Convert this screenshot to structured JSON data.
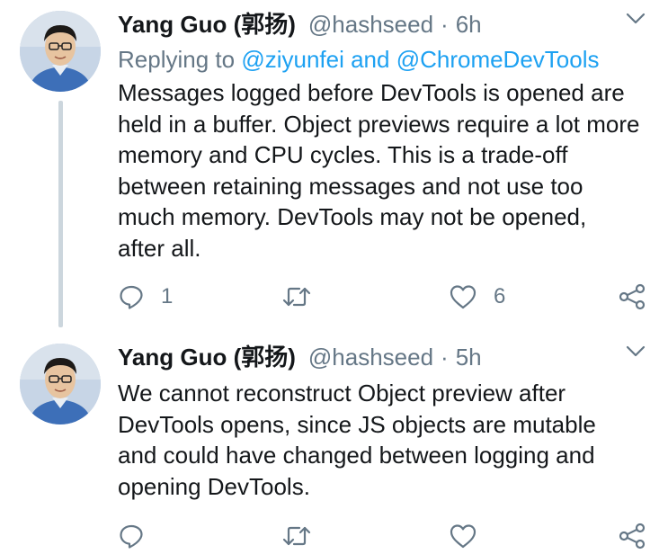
{
  "tweets": [
    {
      "author_name": "Yang Guo (郭扬)",
      "handle": "@hashseed",
      "separator": "·",
      "time": "6h",
      "replying_prefix": "Replying to",
      "replying_mentions": "@ziyunfei and @ChromeDevTools",
      "text": "Messages logged before DevTools is opened are\nheld in a buffer. Object previews require a lot more\nmemory and CPU cycles. This is a trade-off\nbetween retaining messages and not use too\nmuch memory. DevTools may not be opened,\nafter all.",
      "reply_count": "1",
      "retweet_count": "",
      "like_count": "6"
    },
    {
      "author_name": "Yang Guo (郭扬)",
      "handle": "@hashseed",
      "separator": "·",
      "time": "5h",
      "text": "We cannot reconstruct Object preview after\nDevTools opens, since JS objects are mutable\nand could have changed between logging and\nopening DevTools.",
      "reply_count": "",
      "retweet_count": "",
      "like_count": ""
    }
  ],
  "icons": {
    "reply": "reply-icon",
    "retweet": "retweet-icon",
    "like": "heart-icon",
    "share": "share-icon",
    "menu": "chevron-down-icon"
  },
  "colors": {
    "text": "#14171a",
    "muted": "#657786",
    "link": "#1da1f2",
    "thread_line": "#ccd6dd"
  }
}
